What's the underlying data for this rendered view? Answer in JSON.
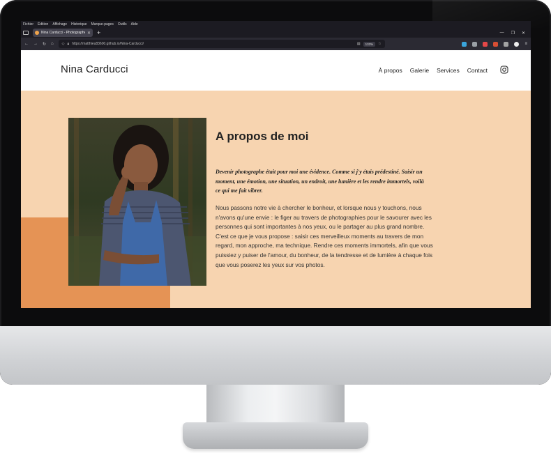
{
  "browser": {
    "menu": [
      "Fichier",
      "Édition",
      "Affichage",
      "Historique",
      "Marque-pages",
      "Outils",
      "Aide"
    ],
    "tab_title": "Nina Carducci - Photographe",
    "url": "https://matthieu83600.github.io/Nina-Carducci/",
    "zoom": "133%"
  },
  "site": {
    "logo": "Nina Carducci",
    "nav": [
      "À propos",
      "Galerie",
      "Services",
      "Contact"
    ],
    "instagram_icon": "instagram-icon",
    "about": {
      "title": "A propos de moi",
      "quote": "Devenir photographe était pour moi une évidence. Comme si j'y étais prédestiné. Saisir un moment, une émotion, une situation, un endroit, une lumière et les rendre immortels, voilà ce qui me fait vibrer.",
      "body": "Nous passons notre vie à chercher le bonheur, et lorsque nous y touchons, nous n'avons qu'une envie : le figer au travers de photographies pour le savourer avec les personnes qui sont importantes à nos yeux, ou le partager au plus grand nombre. C'est ce que je vous propose : saisir ces merveilleux moments au travers de mon regard, mon approche, ma technique. Rendre ces moments immortels, afin que vous puissiez y puiser de l'amour, du bonheur, de la tendresse et de lumière à chaque fois que vous poserez les yeux sur vos photos."
    },
    "colors": {
      "background": "#f7d4b0",
      "accent": "#e59355",
      "header": "#ffffff"
    }
  }
}
